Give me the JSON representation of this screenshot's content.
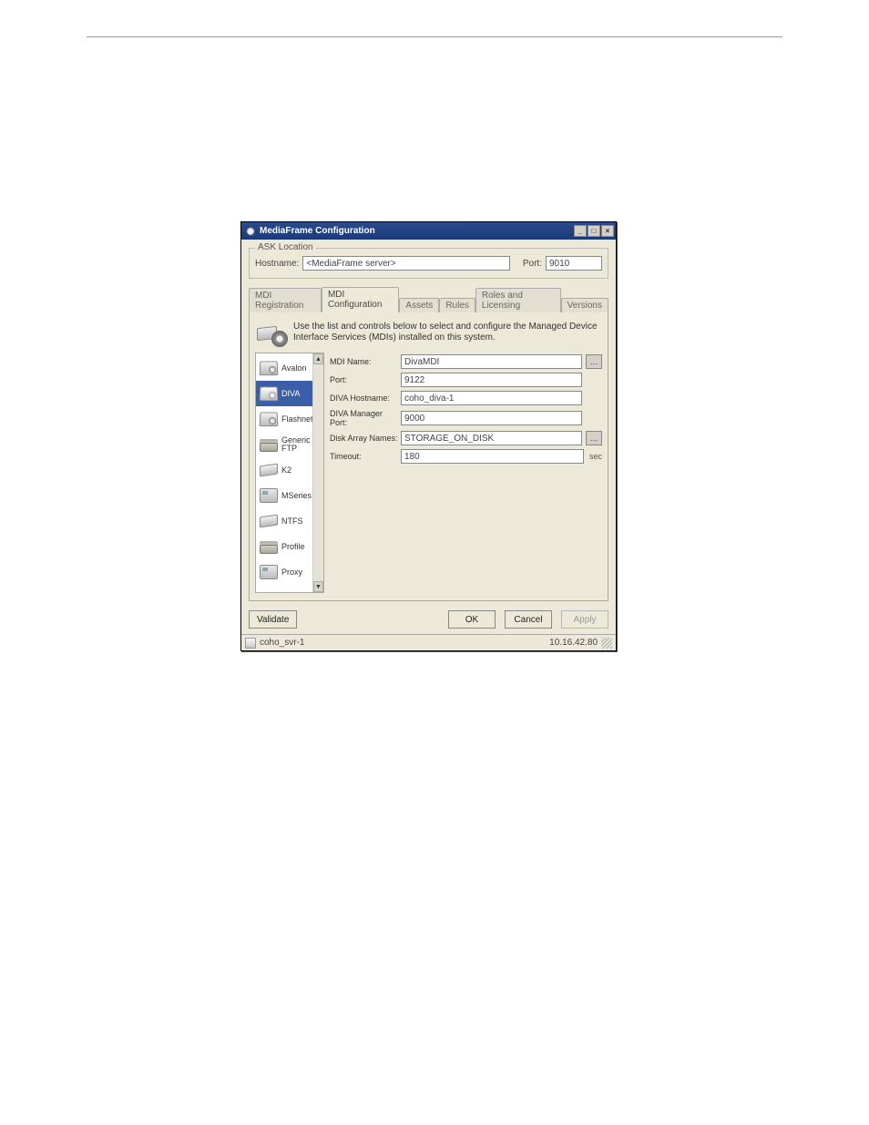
{
  "titlebar": {
    "title": "MediaFrame Configuration"
  },
  "ask": {
    "legend": "ASK Location",
    "hostname_label": "Hostname:",
    "hostname_value": "<MediaFrame server>",
    "port_label": "Port:",
    "port_value": "9010"
  },
  "tabs": {
    "items": [
      "MDI Registration",
      "MDI Configuration",
      "Assets",
      "Rules",
      "Roles and Licensing",
      "Versions"
    ],
    "active_index": 1
  },
  "info_text": "Use the list and controls below to select and configure the Managed Device Interface Services (MDIs) installed on this system.",
  "sidebar": {
    "items": [
      {
        "label": "Avalon",
        "icon": "server"
      },
      {
        "label": "DIVA",
        "icon": "server",
        "selected": true
      },
      {
        "label": "Flashnet",
        "icon": "server"
      },
      {
        "label": "Generic FTP",
        "icon": "stack"
      },
      {
        "label": "K2",
        "icon": "disk"
      },
      {
        "label": "MSeries",
        "icon": "box"
      },
      {
        "label": "NTFS",
        "icon": "disk"
      },
      {
        "label": "Profile",
        "icon": "stack"
      },
      {
        "label": "Proxy",
        "icon": "box"
      }
    ]
  },
  "form": {
    "mdi_name": {
      "label": "MDI Name:",
      "value": "DivaMDI"
    },
    "port": {
      "label": "Port:",
      "value": "9122"
    },
    "diva_hostname": {
      "label": "DIVA Hostname:",
      "value": "coho_diva-1"
    },
    "diva_mgr_port": {
      "label": "DIVA Manager Port:",
      "value": "9000"
    },
    "disk_array": {
      "label": "Disk Array Names:",
      "value": "STORAGE_ON_DISK"
    },
    "timeout": {
      "label": "Timeout:",
      "value": "180",
      "unit": "sec"
    }
  },
  "buttons": {
    "validate": "Validate",
    "ok": "OK",
    "cancel": "Cancel",
    "apply": "Apply"
  },
  "status": {
    "left": "coho_svr-1",
    "right": "10.16.42.80"
  }
}
